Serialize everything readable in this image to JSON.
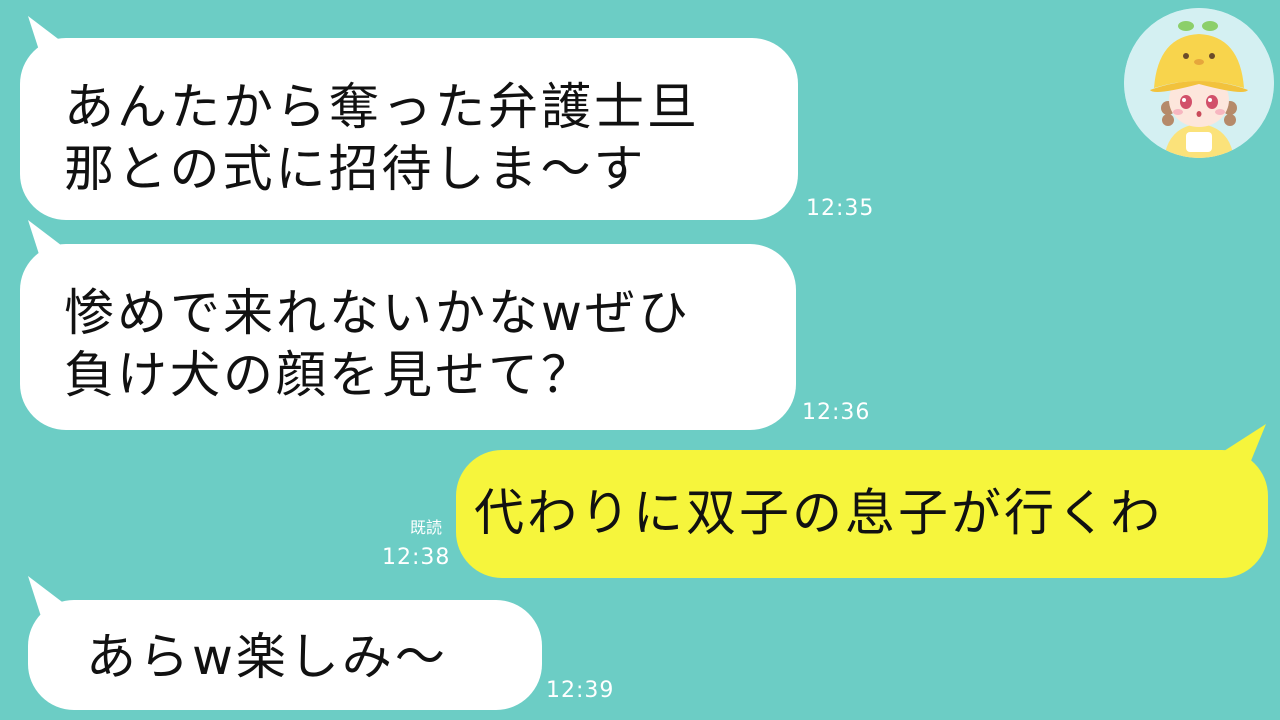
{
  "messages": [
    {
      "side": "in",
      "lines": [
        "あんたから奪った弁護士旦",
        "那との式に招待しま〜す"
      ],
      "time": "12:35"
    },
    {
      "side": "in",
      "lines": [
        "惨めで来れないかなwぜひ",
        "負け犬の顔を見せて？"
      ],
      "time": "12:36"
    },
    {
      "side": "out",
      "lines": [
        "代わりに双子の息子が行くわ"
      ],
      "time": "12:38",
      "read": "既読"
    },
    {
      "side": "in",
      "lines": [
        "あらw楽しみ〜"
      ],
      "time": "12:39"
    }
  ],
  "colors": {
    "background": "#6ccdc5",
    "incoming": "#ffffff",
    "outgoing": "#f6f53c",
    "timestamp": "#ffffff"
  },
  "avatar": {
    "icon": "girl-yellow-hat-avatar-icon"
  }
}
